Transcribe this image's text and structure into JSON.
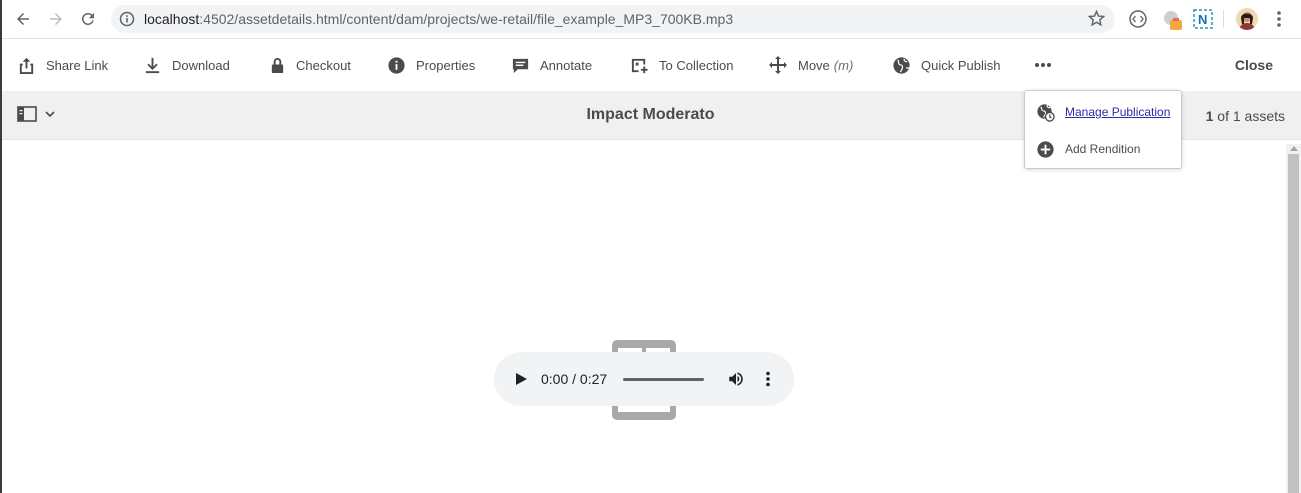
{
  "browser": {
    "url_host": "localhost",
    "url_path": ":4502/assetdetails.html/content/dam/projects/we-retail/file_example_MP3_700KB.mp3"
  },
  "actionbar": {
    "items": [
      {
        "label": "Share Link",
        "icon": "share-icon"
      },
      {
        "label": "Download",
        "icon": "download-icon"
      },
      {
        "label": "Checkout",
        "icon": "lock-icon"
      },
      {
        "label": "Properties",
        "icon": "info-icon"
      },
      {
        "label": "Annotate",
        "icon": "comment-icon"
      },
      {
        "label": "To Collection",
        "icon": "collection-add-icon"
      },
      {
        "label": "Move",
        "shortcut": "(m)",
        "icon": "move-icon"
      },
      {
        "label": "Quick Publish",
        "icon": "globe-icon"
      }
    ],
    "more_icon": "more-horizontal-icon",
    "close_label": "Close"
  },
  "titlebar": {
    "title": "Impact Moderato",
    "count_current": "1",
    "count_rest": " of 1 assets"
  },
  "player": {
    "time": "0:00 / 0:27",
    "progress": 0
  },
  "popover": {
    "items": [
      {
        "label": "Manage Publication",
        "icon": "manage-publication-icon"
      },
      {
        "label": "Add Rendition",
        "icon": "add-circle-icon"
      }
    ]
  },
  "colors": {
    "accent_link": "#2c2ca8",
    "titlebar_bg": "#f0f0f0",
    "text": "#4b4b4b"
  }
}
